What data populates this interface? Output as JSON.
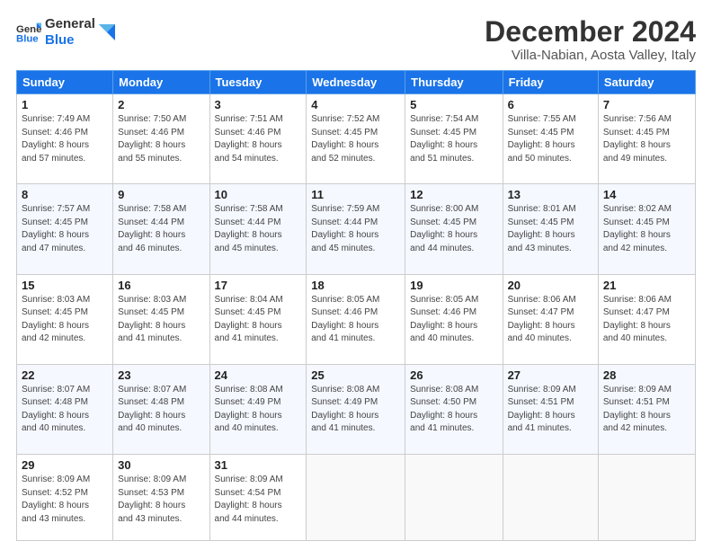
{
  "header": {
    "logo_line1": "General",
    "logo_line2": "Blue",
    "main_title": "December 2024",
    "subtitle": "Villa-Nabian, Aosta Valley, Italy"
  },
  "days_of_week": [
    "Sunday",
    "Monday",
    "Tuesday",
    "Wednesday",
    "Thursday",
    "Friday",
    "Saturday"
  ],
  "weeks": [
    [
      {
        "day": "1",
        "sunrise": "7:49 AM",
        "sunset": "4:46 PM",
        "daylight": "8 hours and 57 minutes."
      },
      {
        "day": "2",
        "sunrise": "7:50 AM",
        "sunset": "4:46 PM",
        "daylight": "8 hours and 55 minutes."
      },
      {
        "day": "3",
        "sunrise": "7:51 AM",
        "sunset": "4:46 PM",
        "daylight": "8 hours and 54 minutes."
      },
      {
        "day": "4",
        "sunrise": "7:52 AM",
        "sunset": "4:45 PM",
        "daylight": "8 hours and 52 minutes."
      },
      {
        "day": "5",
        "sunrise": "7:54 AM",
        "sunset": "4:45 PM",
        "daylight": "8 hours and 51 minutes."
      },
      {
        "day": "6",
        "sunrise": "7:55 AM",
        "sunset": "4:45 PM",
        "daylight": "8 hours and 50 minutes."
      },
      {
        "day": "7",
        "sunrise": "7:56 AM",
        "sunset": "4:45 PM",
        "daylight": "8 hours and 49 minutes."
      }
    ],
    [
      {
        "day": "8",
        "sunrise": "7:57 AM",
        "sunset": "4:45 PM",
        "daylight": "8 hours and 47 minutes."
      },
      {
        "day": "9",
        "sunrise": "7:58 AM",
        "sunset": "4:44 PM",
        "daylight": "8 hours and 46 minutes."
      },
      {
        "day": "10",
        "sunrise": "7:58 AM",
        "sunset": "4:44 PM",
        "daylight": "8 hours and 45 minutes."
      },
      {
        "day": "11",
        "sunrise": "7:59 AM",
        "sunset": "4:44 PM",
        "daylight": "8 hours and 45 minutes."
      },
      {
        "day": "12",
        "sunrise": "8:00 AM",
        "sunset": "4:45 PM",
        "daylight": "8 hours and 44 minutes."
      },
      {
        "day": "13",
        "sunrise": "8:01 AM",
        "sunset": "4:45 PM",
        "daylight": "8 hours and 43 minutes."
      },
      {
        "day": "14",
        "sunrise": "8:02 AM",
        "sunset": "4:45 PM",
        "daylight": "8 hours and 42 minutes."
      }
    ],
    [
      {
        "day": "15",
        "sunrise": "8:03 AM",
        "sunset": "4:45 PM",
        "daylight": "8 hours and 42 minutes."
      },
      {
        "day": "16",
        "sunrise": "8:03 AM",
        "sunset": "4:45 PM",
        "daylight": "8 hours and 41 minutes."
      },
      {
        "day": "17",
        "sunrise": "8:04 AM",
        "sunset": "4:45 PM",
        "daylight": "8 hours and 41 minutes."
      },
      {
        "day": "18",
        "sunrise": "8:05 AM",
        "sunset": "4:46 PM",
        "daylight": "8 hours and 41 minutes."
      },
      {
        "day": "19",
        "sunrise": "8:05 AM",
        "sunset": "4:46 PM",
        "daylight": "8 hours and 40 minutes."
      },
      {
        "day": "20",
        "sunrise": "8:06 AM",
        "sunset": "4:47 PM",
        "daylight": "8 hours and 40 minutes."
      },
      {
        "day": "21",
        "sunrise": "8:06 AM",
        "sunset": "4:47 PM",
        "daylight": "8 hours and 40 minutes."
      }
    ],
    [
      {
        "day": "22",
        "sunrise": "8:07 AM",
        "sunset": "4:48 PM",
        "daylight": "8 hours and 40 minutes."
      },
      {
        "day": "23",
        "sunrise": "8:07 AM",
        "sunset": "4:48 PM",
        "daylight": "8 hours and 40 minutes."
      },
      {
        "day": "24",
        "sunrise": "8:08 AM",
        "sunset": "4:49 PM",
        "daylight": "8 hours and 40 minutes."
      },
      {
        "day": "25",
        "sunrise": "8:08 AM",
        "sunset": "4:49 PM",
        "daylight": "8 hours and 41 minutes."
      },
      {
        "day": "26",
        "sunrise": "8:08 AM",
        "sunset": "4:50 PM",
        "daylight": "8 hours and 41 minutes."
      },
      {
        "day": "27",
        "sunrise": "8:09 AM",
        "sunset": "4:51 PM",
        "daylight": "8 hours and 41 minutes."
      },
      {
        "day": "28",
        "sunrise": "8:09 AM",
        "sunset": "4:51 PM",
        "daylight": "8 hours and 42 minutes."
      }
    ],
    [
      {
        "day": "29",
        "sunrise": "8:09 AM",
        "sunset": "4:52 PM",
        "daylight": "8 hours and 43 minutes."
      },
      {
        "day": "30",
        "sunrise": "8:09 AM",
        "sunset": "4:53 PM",
        "daylight": "8 hours and 43 minutes."
      },
      {
        "day": "31",
        "sunrise": "8:09 AM",
        "sunset": "4:54 PM",
        "daylight": "8 hours and 44 minutes."
      },
      null,
      null,
      null,
      null
    ]
  ],
  "labels": {
    "sunrise": "Sunrise:",
    "sunset": "Sunset:",
    "daylight": "Daylight:"
  }
}
